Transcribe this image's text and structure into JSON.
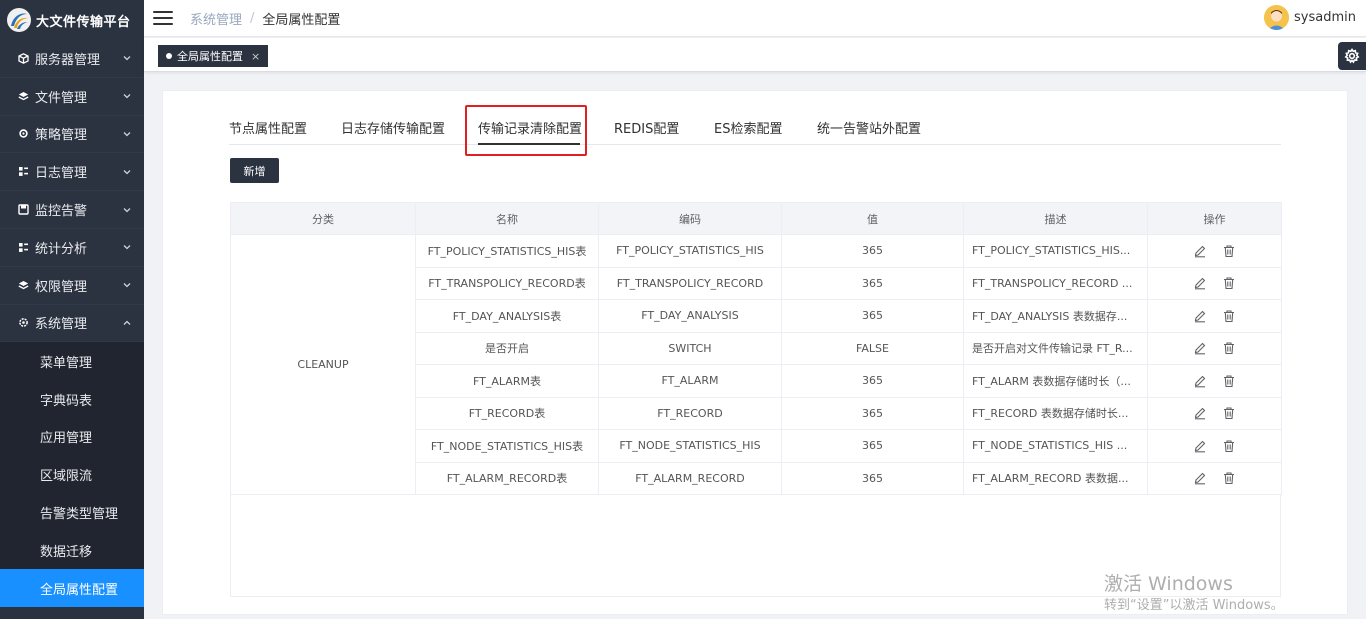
{
  "app": {
    "title": "大文件传输平台"
  },
  "sidebar": {
    "items": [
      {
        "label": "服务器管理",
        "icon": "cube-icon"
      },
      {
        "label": "文件管理",
        "icon": "stack-icon"
      },
      {
        "label": "策略管理",
        "icon": "gear-puzzle-icon"
      },
      {
        "label": "日志管理",
        "icon": "grid-icon"
      },
      {
        "label": "监控告警",
        "icon": "save-icon"
      },
      {
        "label": "统计分析",
        "icon": "grid-icon"
      },
      {
        "label": "权限管理",
        "icon": "stack-icon"
      },
      {
        "label": "系统管理",
        "icon": "settings-icon"
      }
    ],
    "submenu": [
      "菜单管理",
      "字典码表",
      "应用管理",
      "区域限流",
      "告警类型管理",
      "数据迁移",
      "全局属性配置"
    ]
  },
  "header": {
    "breadcrumb": [
      "系统管理",
      "全局属性配置"
    ],
    "breadcrumb_sep": "/",
    "user": "sysadmin"
  },
  "tagsbar": {
    "tag_label": "全局属性配置",
    "tag_close": "×"
  },
  "tabs": [
    "节点属性配置",
    "日志存储传输配置",
    "传输记录清除配置",
    "REDIS配置",
    "ES检索配置",
    "统一告警站外配置"
  ],
  "toolbar": {
    "add_label": "新增"
  },
  "table": {
    "headers": [
      "分类",
      "名称",
      "编码",
      "值",
      "描述",
      "操作"
    ],
    "category": "CLEANUP",
    "rows": [
      {
        "name": "FT_POLICY_STATISTICS_HIS表",
        "code": "FT_POLICY_STATISTICS_HIS",
        "value": "365",
        "desc": "FT_POLICY_STATISTICS_HIS..."
      },
      {
        "name": "FT_TRANSPOLICY_RECORD表",
        "code": "FT_TRANSPOLICY_RECORD",
        "value": "365",
        "desc": "FT_TRANSPOLICY_RECORD ..."
      },
      {
        "name": "FT_DAY_ANALYSIS表",
        "code": "FT_DAY_ANALYSIS",
        "value": "365",
        "desc": "FT_DAY_ANALYSIS 表数据存..."
      },
      {
        "name": "是否开启",
        "code": "SWITCH",
        "value": "FALSE",
        "desc": "是否开启对文件传输记录 FT_R..."
      },
      {
        "name": "FT_ALARM表",
        "code": "FT_ALARM",
        "value": "365",
        "desc": "FT_ALARM 表数据存储时长（..."
      },
      {
        "name": "FT_RECORD表",
        "code": "FT_RECORD",
        "value": "365",
        "desc": "FT_RECORD 表数据存储时长..."
      },
      {
        "name": "FT_NODE_STATISTICS_HIS表",
        "code": "FT_NODE_STATISTICS_HIS",
        "value": "365",
        "desc": "FT_NODE_STATISTICS_HIS ..."
      },
      {
        "name": "FT_ALARM_RECORD表",
        "code": "FT_ALARM_RECORD",
        "value": "365",
        "desc": "FT_ALARM_RECORD 表数据..."
      }
    ]
  },
  "watermark": {
    "line1": "激活 Windows",
    "line2": "转到“设置”以激活 Windows。"
  }
}
